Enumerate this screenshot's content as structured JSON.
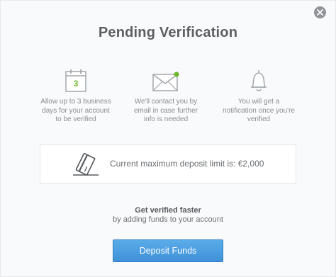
{
  "dialog": {
    "title": "Pending Verification",
    "close_icon": "close-x-icon"
  },
  "steps": [
    {
      "icon": "calendar-icon",
      "icon_text": "3",
      "label_lines": [
        "Allow up to 3 business",
        "days for your account",
        "to be verified"
      ]
    },
    {
      "icon": "envelope-icon",
      "label_lines": [
        "We'll contact you by",
        "email in case further",
        "info is needed"
      ]
    },
    {
      "icon": "bell-icon",
      "label_lines": [
        "You will get a",
        "notification once you're",
        "verified"
      ]
    }
  ],
  "deposit_limit": {
    "icon": "credit-card-icon",
    "text": "Current maximum deposit limit is: €2,000"
  },
  "promo": {
    "title": "Get verified faster",
    "subtitle": "by adding funds to your account"
  },
  "deposit_button": {
    "label": "Deposit Funds"
  },
  "colors": {
    "accent_green": "#6cb52d",
    "button_blue": "#4a9de0",
    "icon_gray": "#a3a7ab",
    "title_gray": "#5c5f63"
  }
}
